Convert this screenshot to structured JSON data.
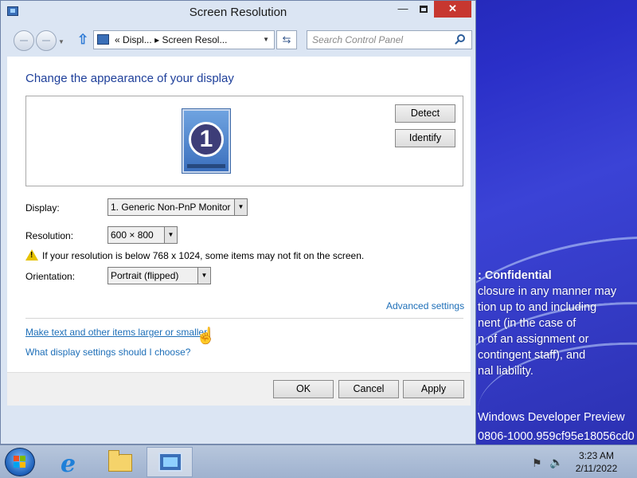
{
  "window": {
    "title": "Screen Resolution",
    "minimize_glyph": "—",
    "close_glyph": "✕"
  },
  "addressbar": {
    "chevron": "«",
    "crumbs": [
      "Displ...",
      "Screen Resol..."
    ],
    "separator": "▸",
    "search_placeholder": "Search Control Panel"
  },
  "content": {
    "heading": "Change the appearance of your display",
    "monitor_number": "1",
    "detect_label": "Detect",
    "identify_label": "Identify",
    "display_label": "Display:",
    "display_value": "1. Generic Non-PnP Monitor",
    "resolution_label": "Resolution:",
    "resolution_value": "600 × 800",
    "warning_text": "If your resolution is below 768 x 1024, some items may not fit on the screen.",
    "orientation_label": "Orientation:",
    "orientation_value": "Portrait (flipped)",
    "advanced_link": "Advanced settings",
    "text_size_link": "Make text and other items larger or smaller",
    "which_settings_link": "What display settings should I choose?"
  },
  "footer": {
    "ok_label": "OK",
    "cancel_label": "Cancel",
    "apply_label": "Apply"
  },
  "watermark": {
    "title": ": Confidential",
    "lines": [
      "closure in any manner may",
      "tion up to and including",
      "nent (in the case of",
      "n of an assignment or",
      "contingent staff), and",
      "nal liability."
    ],
    "product": " Windows Developer Preview",
    "build": "0806-1000.959cf95e18056cd0"
  },
  "taskbar": {
    "time": "3:23 AM",
    "date": "2/11/2022"
  },
  "colors": {
    "link": "#1e6fb8",
    "heading": "#1e3f9a",
    "close_button": "#c7372f",
    "desktop": "#2a2fc8"
  }
}
